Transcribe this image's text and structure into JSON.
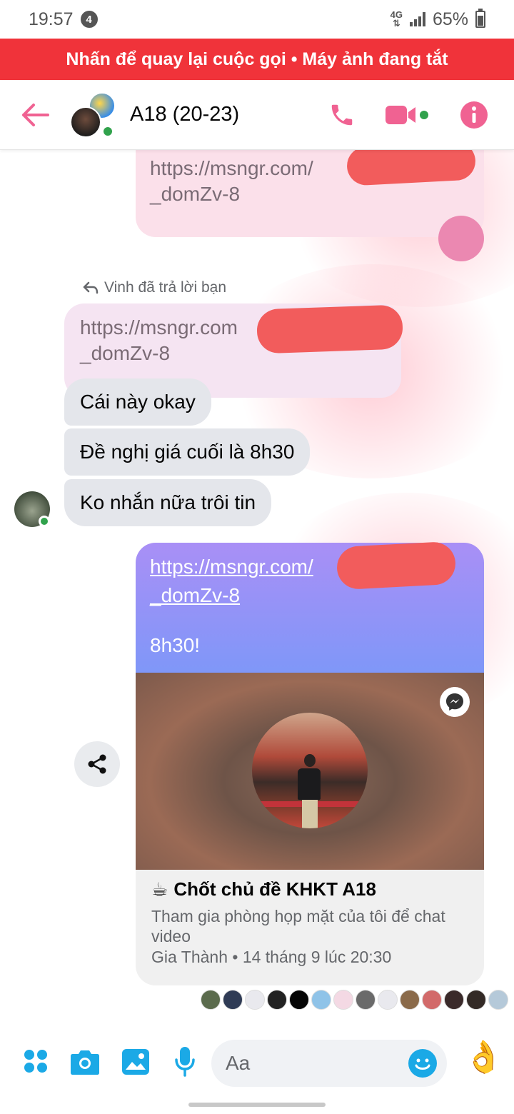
{
  "status_bar": {
    "time": "19:57",
    "notification_count": "4",
    "network_type": "4G",
    "battery_percent": "65%"
  },
  "call_banner": {
    "text": "Nhấn để quay lại cuộc gọi • Máy ảnh đang tắt"
  },
  "header": {
    "title": "A18 (20-23)"
  },
  "messages": {
    "outgoing_link_1": {
      "line1": "https://msngr.com/",
      "line2": "_domZv-8"
    },
    "reply_note": "Vinh đã trả lời bạn",
    "reply_quote": {
      "line1": "https://msngr.com",
      "line2": "_domZv-8"
    },
    "incoming": [
      {
        "text": "Cái này okay"
      },
      {
        "text": "Đề nghị giá cuối là 8h30"
      },
      {
        "text": "Ko nhắn nữa trôi tin"
      }
    ],
    "room_card": {
      "link_line1": "https://msngr.com/",
      "link_line2": "_domZv-8",
      "time_text": "8h30!",
      "title_emoji": "☕",
      "title": "Chốt chủ đề KHKT A18",
      "description": "Tham gia phòng họp mặt của tôi để chat video",
      "meta": "Gia Thành • 14 tháng 9 lúc 20:30"
    }
  },
  "composer": {
    "placeholder": "Aa",
    "quick_reaction": "👌"
  },
  "colors": {
    "call_banner": "#f0333a",
    "accent_pink": "#f06292",
    "composer_blue": "#1ba9e6",
    "online_green": "#31a24c",
    "incoming_bubble": "#e4e6eb"
  },
  "icons": {
    "header": [
      "back-arrow-icon",
      "phone-icon",
      "video-camera-icon",
      "info-icon"
    ],
    "composer": [
      "apps-icon",
      "camera-icon",
      "gallery-icon",
      "microphone-icon",
      "emoji-icon"
    ],
    "card": [
      "messenger-icon",
      "share-icon"
    ]
  }
}
